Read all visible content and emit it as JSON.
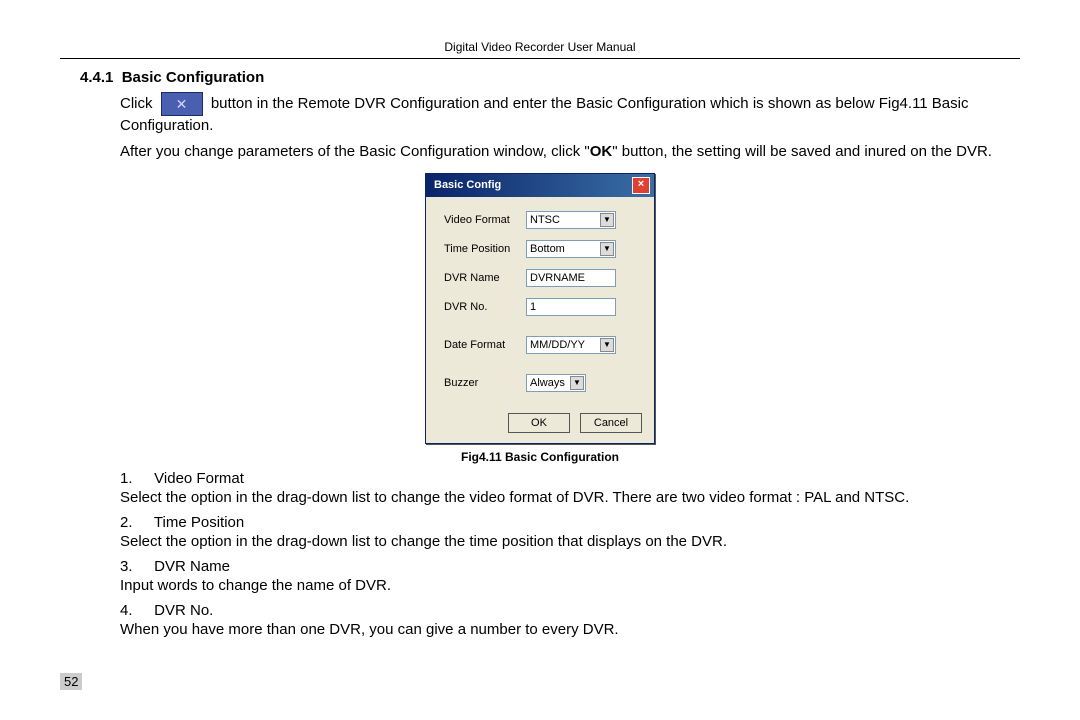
{
  "header": "Digital Video Recorder User Manual",
  "section_number": "4.4.1",
  "section_title": "Basic Configuration",
  "para1_prefix": "Click",
  "para1_suffix": "button in the Remote DVR Configuration and enter the Basic Configuration which is shown as below Fig4.11 Basic Configuration.",
  "para2_a": "After you change parameters of the Basic Configuration window, click \"",
  "para2_ok": "OK",
  "para2_b": "\" button, the setting will be saved and inured on the DVR.",
  "dialog": {
    "title": "Basic Config",
    "fields": {
      "video_format": {
        "label": "Video Format",
        "value": "NTSC"
      },
      "time_position": {
        "label": "Time Position",
        "value": "Bottom"
      },
      "dvr_name": {
        "label": "DVR Name",
        "value": "DVRNAME"
      },
      "dvr_no": {
        "label": "DVR No.",
        "value": "1"
      },
      "date_format": {
        "label": "Date Format",
        "value": "MM/DD/YY"
      },
      "buzzer": {
        "label": "Buzzer",
        "value": "Always"
      }
    },
    "ok": "OK",
    "cancel": "Cancel"
  },
  "fig_caption": "Fig4.11 Basic Configuration",
  "items": [
    {
      "num": "1.",
      "title": "Video Format",
      "desc": "Select the option in the drag-down list to change the video format of DVR. There are two video format : PAL and NTSC."
    },
    {
      "num": "2.",
      "title": "Time Position",
      "desc": "Select the option in the drag-down list to change the time position that displays on the DVR."
    },
    {
      "num": "3.",
      "title": "DVR Name",
      "desc": "Input words to change the name of DVR."
    },
    {
      "num": "4.",
      "title": "DVR No.",
      "desc": "When you have more than one DVR, you can give a number to every DVR."
    }
  ],
  "page_number": "52"
}
